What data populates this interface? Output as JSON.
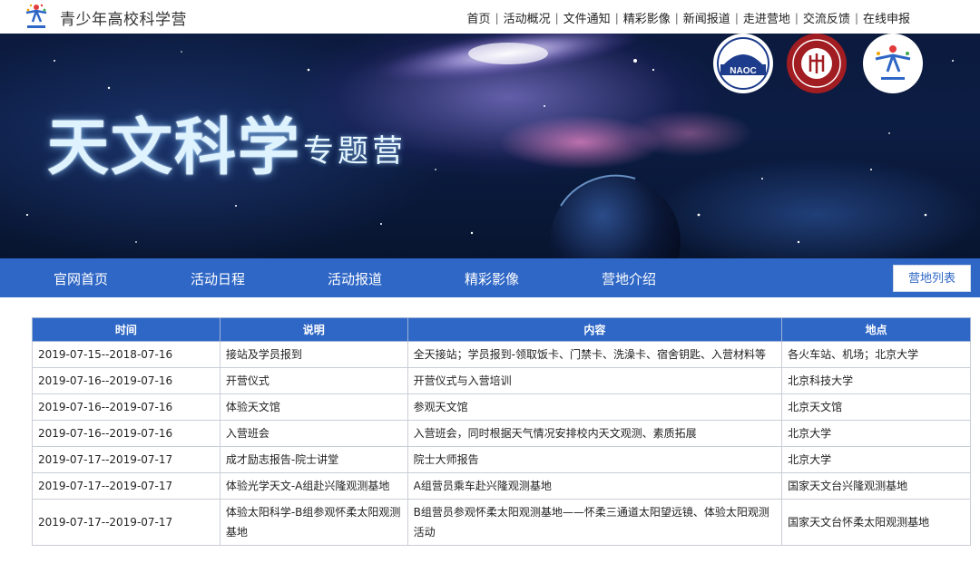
{
  "header": {
    "site_title": "青少年高校科学营",
    "logo_icon": "camp-logo-icon",
    "nav": [
      "首页",
      "活动概况",
      "文件通知",
      "精彩影像",
      "新闻报道",
      "走进营地",
      "交流反馈",
      "在线申报"
    ]
  },
  "banner": {
    "title": "天文科学",
    "subtitle": "专题营",
    "badges": [
      {
        "icon": "naoc-logo-icon",
        "text": "NAOC"
      },
      {
        "icon": "peking-university-seal-icon"
      },
      {
        "icon": "camp-logo-icon"
      }
    ]
  },
  "main_nav": {
    "items": [
      "官网首页",
      "活动日程",
      "活动报道",
      "精彩影像",
      "营地介绍"
    ],
    "list_button": "营地列表",
    "color": "#2f67c6"
  },
  "schedule": {
    "headers": [
      "时间",
      "说明",
      "内容",
      "地点"
    ],
    "rows": [
      [
        "2019-07-15--2018-07-16",
        "接站及学员报到",
        "全天接站；学员报到-领取饭卡、门禁卡、洗澡卡、宿舍钥匙、入营材料等",
        "各火车站、机场；北京大学"
      ],
      [
        "2019-07-16--2019-07-16",
        "开营仪式",
        "开营仪式与入营培训",
        "北京科技大学"
      ],
      [
        "2019-07-16--2019-07-16",
        "体验天文馆",
        "参观天文馆",
        "北京天文馆"
      ],
      [
        "2019-07-16--2019-07-16",
        "入营班会",
        "入营班会，同时根据天气情况安排校内天文观测、素质拓展",
        "北京大学"
      ],
      [
        "2019-07-17--2019-07-17",
        "成才励志报告-院士讲堂",
        "院士大师报告",
        "北京大学"
      ],
      [
        "2019-07-17--2019-07-17",
        "体验光学天文-A组赴兴隆观测基地",
        "A组营员乘车赴兴隆观测基地",
        "国家天文台兴隆观测基地"
      ],
      [
        "2019-07-17--2019-07-17",
        "体验太阳科学-B组参观怀柔太阳观测基地",
        "B组营员参观怀柔太阳观测基地——怀柔三通道太阳望远镜、体验太阳观测活动",
        "国家天文台怀柔太阳观测基地"
      ]
    ]
  }
}
